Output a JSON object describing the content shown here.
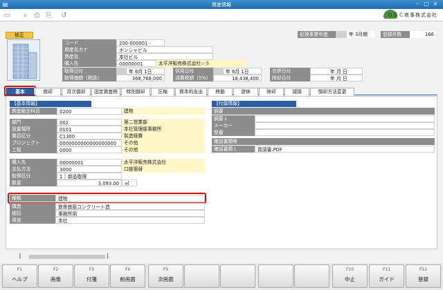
{
  "window": {
    "title": "資産情報",
    "company": "ＯＢＣ商事株式会社"
  },
  "mode_badge": "修正",
  "fiscal": {
    "label": "処理事業年度",
    "year_suffix": "年",
    "month": "3月期",
    "count_label": "登録件数",
    "count": "166"
  },
  "header_fields": [
    {
      "label": "コード",
      "value": "200-000001 -"
    },
    {
      "label": "資産名カナ",
      "value": "ホンシャビル"
    },
    {
      "label": "資産名",
      "value": "本社ビル"
    },
    {
      "label": "購入先",
      "value": "00000001",
      "extra": "太平洋販売株式会社☆彡"
    }
  ],
  "dates": {
    "acquire_label": "取得日付",
    "acquire_value": "年  6月  1日",
    "use_label": "供用日付",
    "use_value": "年  6月  1日",
    "merge_label": "合併日付",
    "merge_value": "年    月    日",
    "price_label": "取得価額（税抜）",
    "price_value": "368,768,000",
    "tax_label": "消費税額（5%）",
    "tax_value": "18,438,400",
    "dispose_label": "除却日付",
    "dispose_value": "年    月    日"
  },
  "tabs": [
    "基本",
    "償却",
    "月次償却",
    "固定資産税",
    "特別償却",
    "圧縮",
    "資本的支出",
    "移動",
    "遊休",
    "除却",
    "減損",
    "償却方法変更"
  ],
  "basic": {
    "header": "【基本情報】",
    "rows1": [
      {
        "label": "資産勘定科目",
        "code": "0200",
        "name": "建物"
      }
    ],
    "rows2": [
      {
        "label": "部門",
        "code": "002",
        "name": "第二営業部"
      },
      {
        "label": "設置場所",
        "code": "0101",
        "name": "本社管理部事務所"
      },
      {
        "label": "費目区分",
        "code": "C1300",
        "name": "製造経費"
      },
      {
        "label": "プロジェクト",
        "code": "0000000000000000000",
        "name": "その他"
      },
      {
        "label": "工程",
        "code": "0000",
        "name": "その他"
      }
    ],
    "rows3": [
      {
        "label": "購入先",
        "code": "00000001",
        "name": "太平洋販売株式会社"
      },
      {
        "label": "支払方法",
        "code": "3000",
        "name": "口座振替"
      },
      {
        "label": "取得区分",
        "code": "1",
        "name": "新品取得"
      },
      {
        "label": "数量",
        "code": "3,093.00",
        "name": "㎡"
      }
    ],
    "rows4": [
      {
        "label": "種類",
        "value": "建物"
      },
      {
        "label": "構造",
        "value": "鉄骨鉄筋コンクリート造"
      },
      {
        "label": "細目",
        "value": "事務所用"
      },
      {
        "label": "用途",
        "value": "本社"
      }
    ]
  },
  "attach": {
    "header": "【付属情報】",
    "rows": [
      {
        "label": "摘要"
      },
      {
        "label": "摘要１"
      },
      {
        "label": "メーカー"
      },
      {
        "label": "型番"
      }
    ],
    "doc_header": "確認書類等",
    "doc_row": {
      "label": "確認書類１",
      "value": "買請書.PDF"
    }
  },
  "status_bracket_left": "[",
  "status_bracket_right": "]",
  "fkeys": [
    {
      "key": "F1",
      "label": "ヘルプ"
    },
    {
      "key": "F2",
      "label": "画像"
    },
    {
      "key": "F3",
      "label": "付箋"
    },
    {
      "key": "F4",
      "label": "前画面"
    },
    {
      "key": "F5",
      "label": "次画面"
    },
    {
      "key": "",
      "label": ""
    },
    {
      "key": "",
      "label": ""
    },
    {
      "key": "",
      "label": ""
    },
    {
      "key": "",
      "label": ""
    },
    {
      "key": "F10",
      "label": "中止"
    },
    {
      "key": "F11",
      "label": "ガイド"
    },
    {
      "key": "F12",
      "label": "登録"
    }
  ]
}
